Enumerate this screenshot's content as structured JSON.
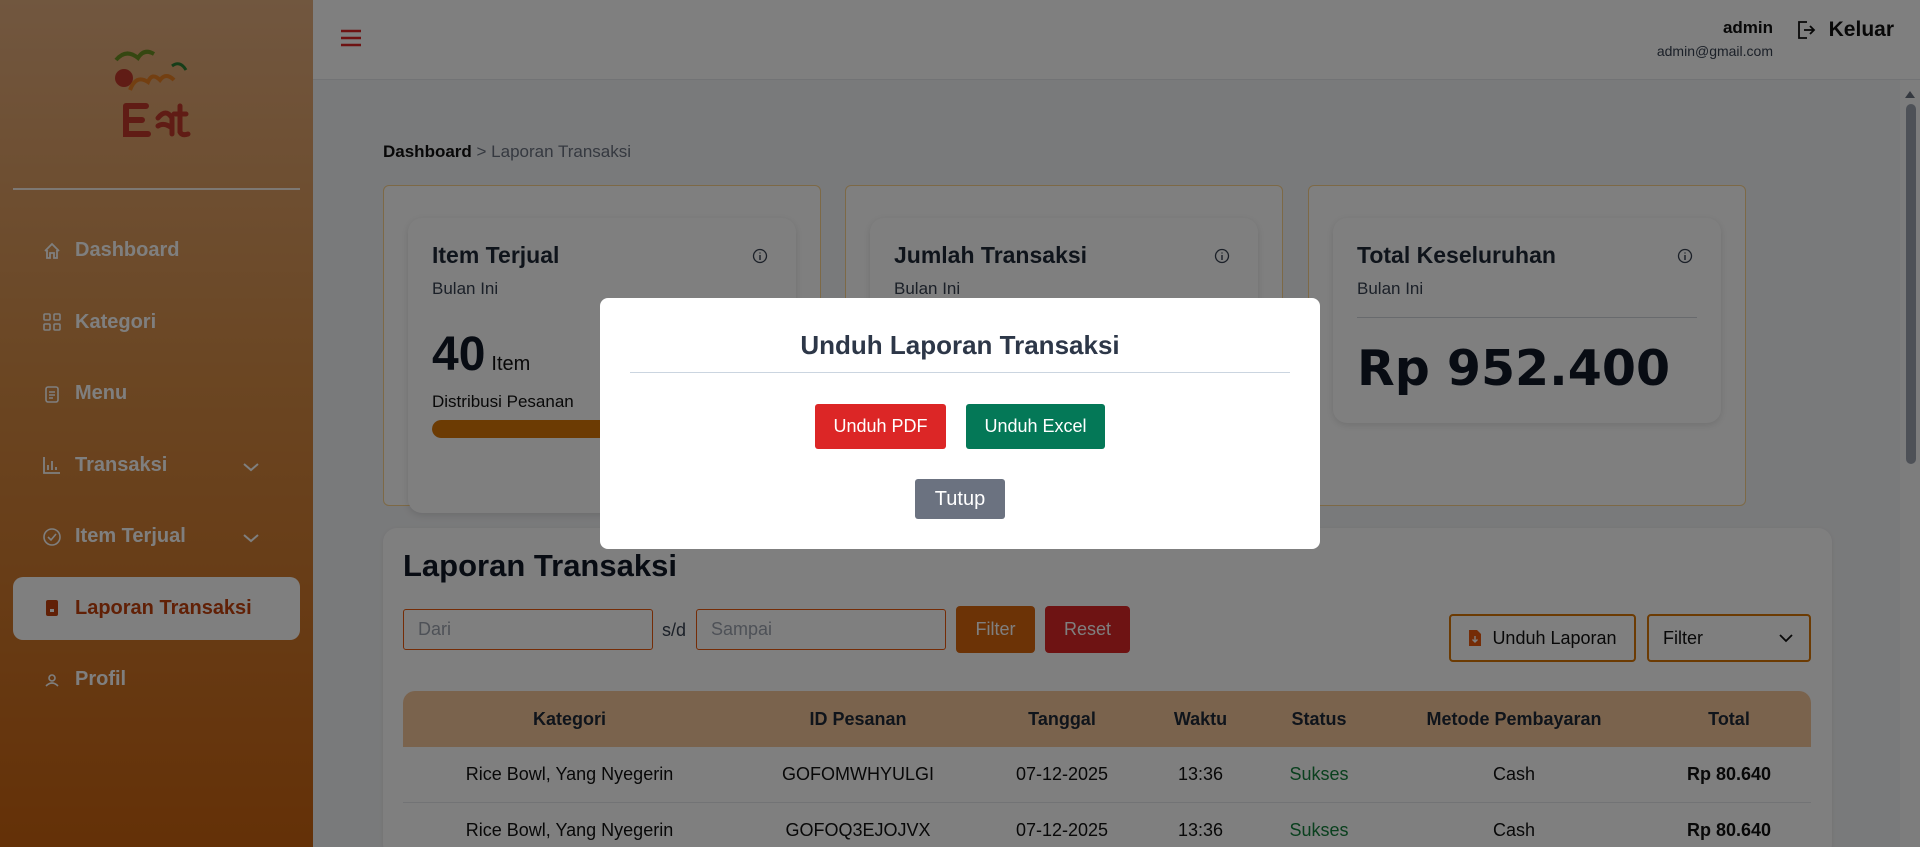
{
  "sidebar": {
    "items": [
      {
        "label": "Dashboard",
        "icon": "home-icon"
      },
      {
        "label": "Kategori",
        "icon": "grid-icon"
      },
      {
        "label": "Menu",
        "icon": "clipboard-icon"
      },
      {
        "label": "Transaksi",
        "icon": "bar-chart-icon"
      },
      {
        "label": "Item Terjual",
        "icon": "check-circle-icon"
      },
      {
        "label": "Laporan Transaksi",
        "icon": "document-icon"
      },
      {
        "label": "Profil",
        "icon": "user-icon"
      }
    ]
  },
  "header": {
    "user_name": "admin",
    "user_email": "admin@gmail.com",
    "logout_label": "Keluar"
  },
  "breadcrumb": {
    "root": "Dashboard",
    "current": "> Laporan Transaksi"
  },
  "cards": [
    {
      "title": "Item Terjual",
      "subtitle": "Bulan Ini",
      "value": "40",
      "unit": "Item",
      "footer": "Distribusi Pesanan"
    },
    {
      "title": "Jumlah Transaksi",
      "subtitle": "Bulan Ini"
    },
    {
      "title": "Total Keseluruhan",
      "subtitle": "Bulan Ini",
      "value": "Rp 952.400"
    }
  ],
  "report": {
    "title": "Laporan Transaksi",
    "from_placeholder": "Dari",
    "separator": "s/d",
    "to_placeholder": "Sampai",
    "filter_label": "Filter",
    "reset_label": "Reset",
    "download_label": "Unduh Laporan",
    "select_value": "Filter",
    "columns": [
      "Kategori",
      "ID Pesanan",
      "Tanggal",
      "Waktu",
      "Status",
      "Metode Pembayaran",
      "Total"
    ],
    "rows": [
      [
        "Rice Bowl, Yang Nyegerin",
        "GOFOMWHYULGI",
        "07-12-2025",
        "13:36",
        "Sukses",
        "Cash",
        "Rp 80.640"
      ],
      [
        "Rice Bowl, Yang Nyegerin",
        "GOFOQ3EJOJVX",
        "07-12-2025",
        "13:36",
        "Sukses",
        "Cash",
        "Rp 80.640"
      ]
    ]
  },
  "modal": {
    "title": "Unduh Laporan Transaksi",
    "pdf_label": "Unduh PDF",
    "excel_label": "Unduh Excel",
    "close_label": "Tutup"
  },
  "colors": {
    "accent": "#d97706",
    "danger": "#dc2626",
    "success": "#047857",
    "header_row": "#f5c79b"
  }
}
